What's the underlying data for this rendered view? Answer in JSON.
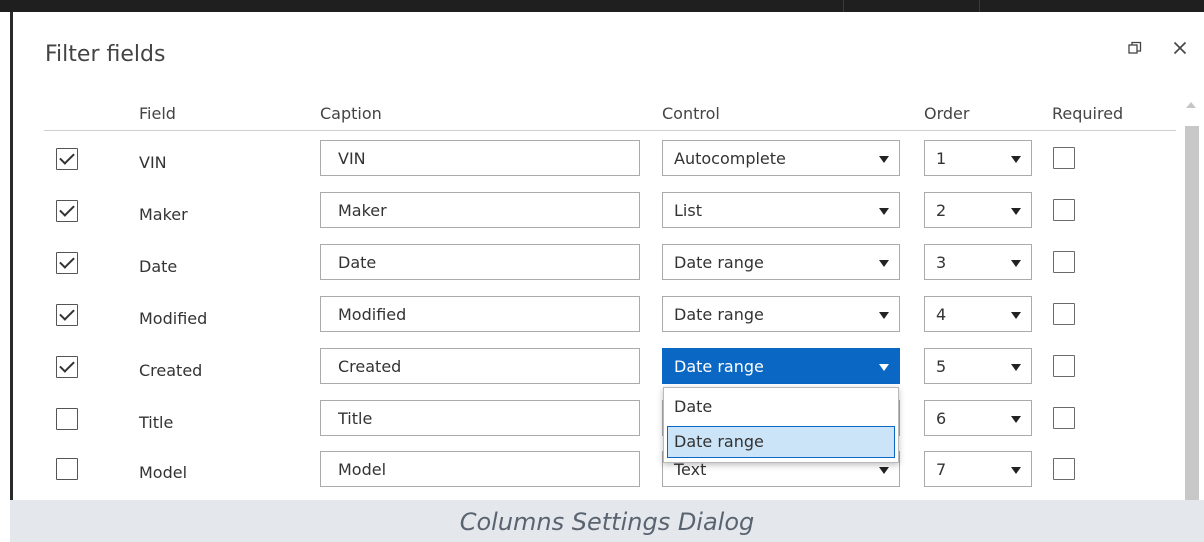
{
  "dialog": {
    "title": "Filter fields",
    "restore_icon": "restore-window-icon",
    "close_icon": "close-icon"
  },
  "columns": {
    "field": "Field",
    "caption": "Caption",
    "control": "Control",
    "order": "Order",
    "required": "Required"
  },
  "rows": [
    {
      "checked": true,
      "field": "VIN",
      "caption": "VIN",
      "control": "Autocomplete",
      "order": "1",
      "required": false
    },
    {
      "checked": true,
      "field": "Maker",
      "caption": "Maker",
      "control": "List",
      "order": "2",
      "required": false
    },
    {
      "checked": true,
      "field": "Date",
      "caption": "Date",
      "control": "Date range",
      "order": "3",
      "required": false
    },
    {
      "checked": true,
      "field": "Modified",
      "caption": "Modified",
      "control": "Date range",
      "order": "4",
      "required": false
    },
    {
      "checked": true,
      "field": "Created",
      "caption": "Created",
      "control": "Date range",
      "order": "5",
      "required": false
    },
    {
      "checked": false,
      "field": "Title",
      "caption": "Title",
      "control": "",
      "order": "6",
      "required": false
    },
    {
      "checked": false,
      "field": "Model",
      "caption": "Model",
      "control": "Text",
      "order": "7",
      "required": false
    }
  ],
  "dropdown": {
    "options": [
      "Date",
      "Date range"
    ],
    "selected": "Date range"
  },
  "footer": {
    "caption": "Columns Settings Dialog"
  },
  "colors": {
    "accent": "#0a67c4",
    "highlight": "#cce4f7",
    "footer_bg": "#e4e8ec"
  }
}
